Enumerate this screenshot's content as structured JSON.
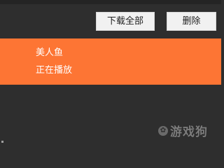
{
  "toolbar": {
    "download_all_label": "下载全部",
    "delete_label": "删除"
  },
  "list": {
    "items": [
      {
        "title": "美人鱼",
        "status": "正在播放",
        "selected": true
      }
    ]
  },
  "watermark": {
    "text": "游戏狗",
    "logo_icon": "paw-icon"
  },
  "colors": {
    "background": "#2e2e2e",
    "accent": "#fd7534",
    "button_bg": "#f1f1f1"
  }
}
